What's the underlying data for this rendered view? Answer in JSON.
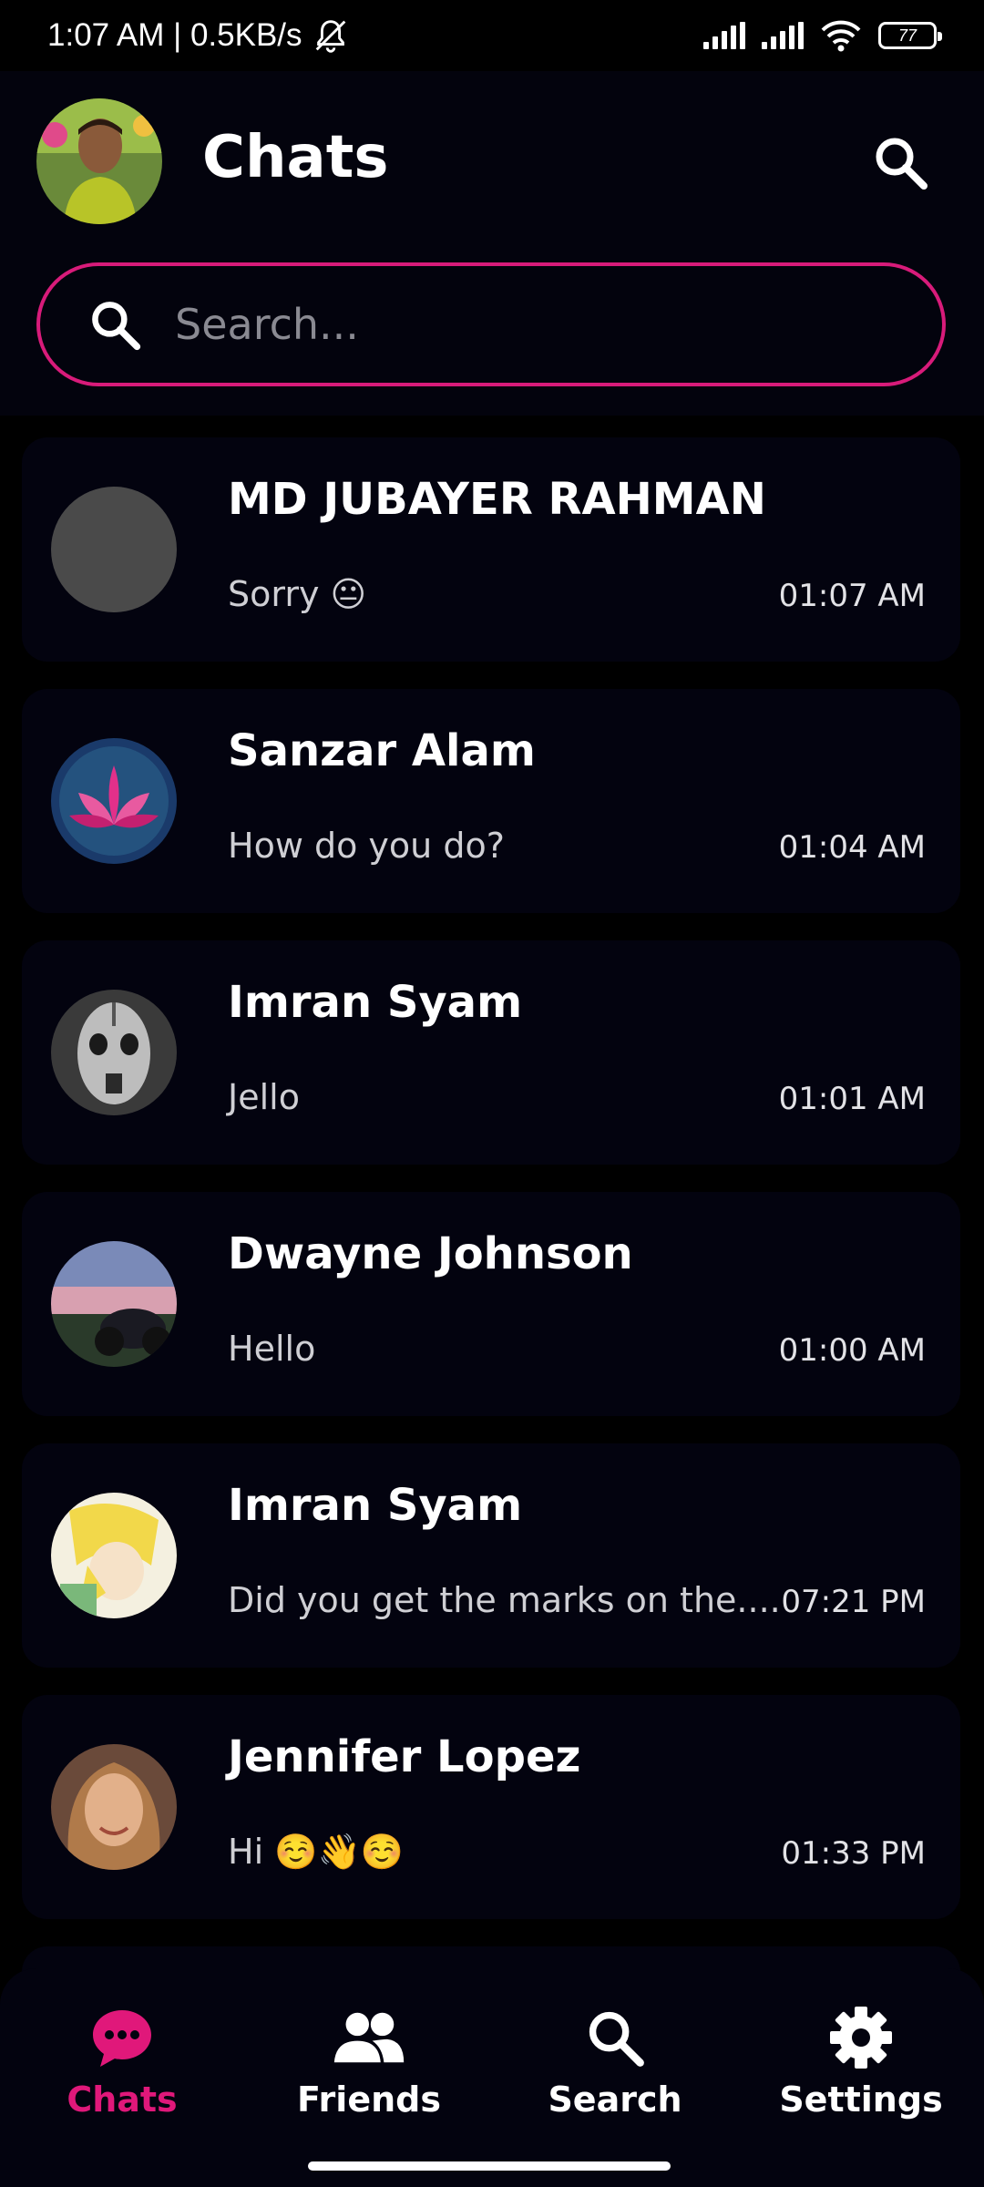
{
  "status_bar": {
    "time": "1:07 AM | 0.5KB/s",
    "battery": "77"
  },
  "header": {
    "title": "Chats",
    "search_placeholder": "Search..."
  },
  "chats": [
    {
      "name": "MD JUBAYER RAHMAN",
      "message": "Sorry 😐",
      "time": "01:07 AM"
    },
    {
      "name": "Sanzar Alam",
      "message": "How do you do?",
      "time": "01:04 AM"
    },
    {
      "name": "Imran Syam",
      "message": "Jello",
      "time": "01:01 AM"
    },
    {
      "name": "Dwayne Johnson",
      "message": "Hello",
      "time": "01:00 AM"
    },
    {
      "name": "Imran Syam",
      "message": "Did you get the marks on the....",
      "time": "07:21 PM"
    },
    {
      "name": "Jennifer Lopez",
      "message": "Hi ☺️👋☺️",
      "time": "01:33 PM"
    }
  ],
  "bottom_nav": {
    "items": [
      {
        "label": "Chats",
        "icon": "chat-bubble-icon",
        "active": true
      },
      {
        "label": "Friends",
        "icon": "friends-icon",
        "active": false
      },
      {
        "label": "Search",
        "icon": "search-icon",
        "active": false
      },
      {
        "label": "Settings",
        "icon": "gear-icon",
        "active": false
      }
    ]
  },
  "colors": {
    "accent": "#e0187a",
    "background": "#000000",
    "card": "#03030f"
  }
}
